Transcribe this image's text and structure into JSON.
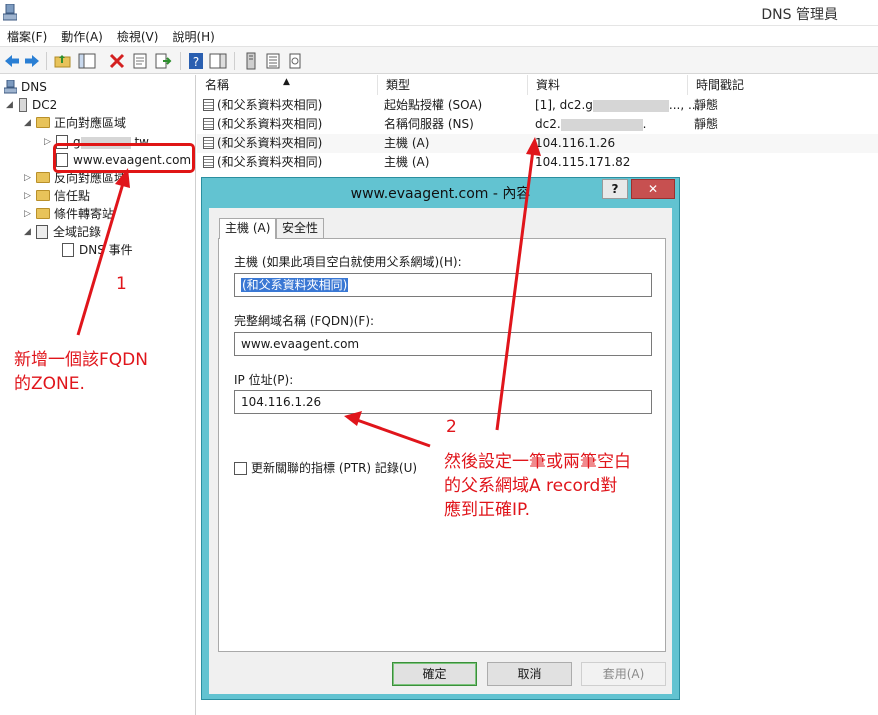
{
  "window": {
    "title": "DNS 管理員"
  },
  "menu": [
    "檔案(F)",
    "動作(A)",
    "檢視(V)",
    "說明(H)"
  ],
  "toolbar_icons": [
    "back-arrow-icon",
    "forward-arrow-icon",
    "folder-up-icon",
    "console-tree-icon",
    "delete-icon",
    "properties-icon",
    "export-icon",
    "help-icon",
    "show-pane-icon",
    "server-icon",
    "list-icon",
    "record-icon"
  ],
  "tree": {
    "root": "DNS",
    "server": "DC2",
    "forward_zones": "正向對應區域",
    "zone_blurred_prefix": "g",
    "zone_blurred_suffix": ".tw",
    "selected_zone": "www.evaagent.com",
    "reverse_zones": "反向對應區域",
    "trust_points": "信任點",
    "conditional_forwarders": "條件轉寄站",
    "global_logs": "全域記錄",
    "dns_events": "DNS 事件"
  },
  "list": {
    "columns": [
      "名稱",
      "類型",
      "資料",
      "時間戳記"
    ],
    "rows": [
      {
        "name": "(和父系資料夾相同)",
        "type": "起始點授權 (SOA)",
        "data_prefix": "[1], dc2.g",
        "data_suffix": "..., ...",
        "timestamp": "靜態"
      },
      {
        "name": "(和父系資料夾相同)",
        "type": "名稱伺服器 (NS)",
        "data_prefix": "dc2.",
        "data_suffix": ".",
        "timestamp": "靜態"
      },
      {
        "name": "(和父系資料夾相同)",
        "type": "主機 (A)",
        "data_prefix": "104.116.1.26",
        "data_suffix": "",
        "timestamp": ""
      },
      {
        "name": "(和父系資料夾相同)",
        "type": "主機 (A)",
        "data_prefix": "104.115.171.82",
        "data_suffix": "",
        "timestamp": ""
      }
    ]
  },
  "dialog": {
    "title": "www.evaagent.com - 內容",
    "help_label": "?",
    "close_label": "✕",
    "tabs": [
      "主機 (A)",
      "安全性"
    ],
    "fields": {
      "host_label": "主機 (如果此項目空白就使用父系網域)(H):",
      "host_value": "(和父系資料夾相同)",
      "fqdn_label": "完整網域名稱 (FQDN)(F):",
      "fqdn_value": "www.evaagent.com",
      "ip_label": "IP 位址(P):",
      "ip_value": "104.116.1.26"
    },
    "ptr_checkbox": "更新關聯的指標 (PTR) 記錄(U)",
    "ptr_checked": false,
    "buttons": {
      "ok": "確定",
      "cancel": "取消",
      "apply": "套用(A)"
    }
  },
  "annotations": {
    "num1": "1",
    "note1_line1": "新增一個該FQDN",
    "note1_line2": "的ZONE.",
    "num2": "2",
    "note2_line1": "然後設定一筆或兩筆空白",
    "note2_line2": "的父系網域A record對",
    "note2_line3": "應到正確IP.",
    "color": "#e0151b"
  }
}
